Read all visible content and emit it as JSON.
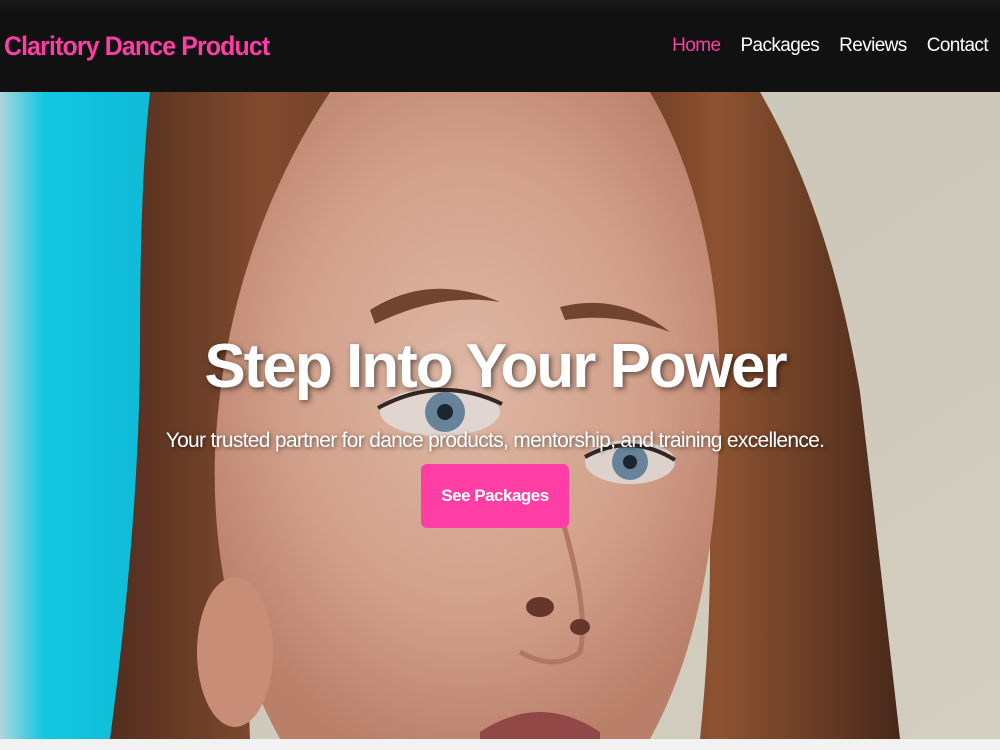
{
  "header": {
    "brand": "Claritory Dance Product",
    "nav": [
      {
        "label": "Home",
        "active": true
      },
      {
        "label": "Packages",
        "active": false
      },
      {
        "label": "Reviews",
        "active": false
      },
      {
        "label": "Contact",
        "active": false
      }
    ]
  },
  "hero": {
    "title": "Step Into Your Power",
    "subtitle": "Your trusted partner for dance products, mentorship, and training excellence.",
    "cta_label": "See Packages",
    "background": "photo-portrait-woman-closeup"
  },
  "colors": {
    "accent": "#ff3ea5",
    "navbar": "#111111",
    "text_light": "#ffffff",
    "backdrop_cyan": "#12d6f2"
  }
}
